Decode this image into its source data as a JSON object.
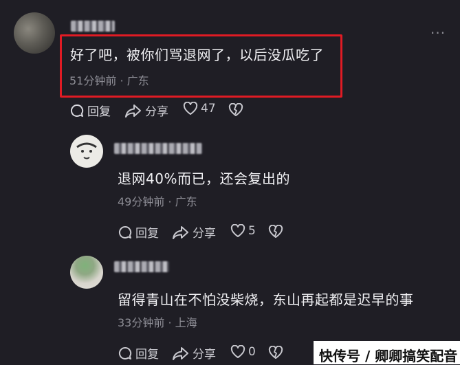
{
  "comments": [
    {
      "content": "好了吧，被你们骂退网了，以后没瓜吃了",
      "time": "51分钟前",
      "location": "广东",
      "reply_label": "回复",
      "share_label": "分享",
      "like_count": "47"
    },
    {
      "content": "退网40%而已，还会复出的",
      "time": "49分钟前",
      "location": "广东",
      "reply_label": "回复",
      "share_label": "分享",
      "like_count": "5"
    },
    {
      "content": "留得青山在不怕没柴烧，东山再起都是迟早的事",
      "time": "33分钟前",
      "location": "上海",
      "reply_label": "回复",
      "share_label": "分享",
      "like_count": "0"
    }
  ],
  "meta_separator": " · ",
  "more_menu": "···",
  "watermark": "快传号 / 卿卿搞笑配音",
  "colors": {
    "background": "#1f1e25",
    "highlight": "#e01b24"
  }
}
